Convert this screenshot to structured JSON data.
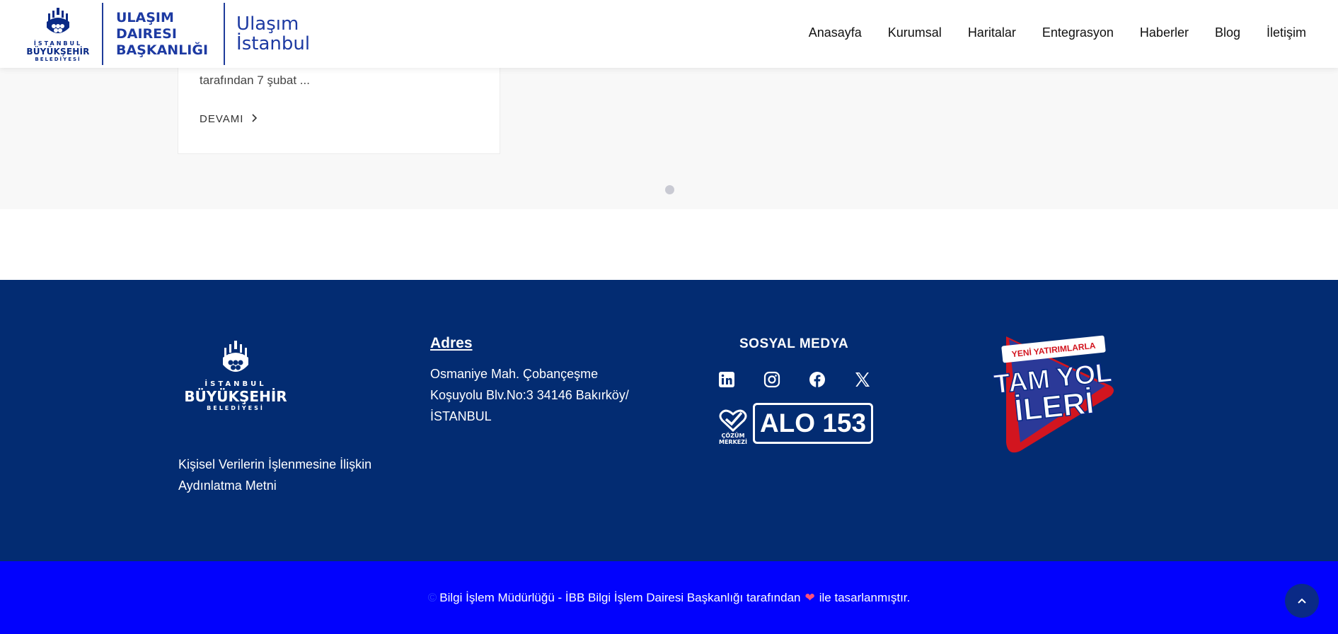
{
  "header": {
    "ibb_logo": {
      "line1": "İSTANBUL",
      "line2": "BÜYÜKŞEHİR",
      "line3": "BELEDİYESİ"
    },
    "department": [
      "ULAŞIM",
      "DAIRESI",
      "BAŞKANLIĞI"
    ],
    "brand": [
      "Ulaşım",
      "İstanbul"
    ],
    "nav": [
      "Anasayfa",
      "Kurumsal",
      "Haritalar",
      "Entegrasyon",
      "Haberler",
      "Blog",
      "İletişim"
    ]
  },
  "card": {
    "excerpt": "tarafından 7 şubat ...",
    "more_label": "DEVAMI",
    "more_icon": "chevron-right-icon"
  },
  "footer": {
    "logo": {
      "line1": "İSTANBUL",
      "line2": "BÜYÜKŞEHİR",
      "line3": "BELEDİYESİ"
    },
    "kvkk": "Kişisel Verilerin İşlenmesine İlişkin Aydınlatma Metni",
    "address_title": "Adres",
    "address_lines": [
      "Osmaniye Mah. Çobançeşme",
      "Koşuyolu Blv.No:3 34146 Bakırköy/",
      "İSTANBUL"
    ],
    "social_title": "SOSYAL MEDYA",
    "social": [
      "linkedin-icon",
      "instagram-icon",
      "facebook-icon",
      "x-icon"
    ],
    "alo_badge": {
      "top": "ÇÖZÜM",
      "bottom": "MERKEZİ",
      "number": "ALO 153"
    },
    "campaign": {
      "line1": "YENİ YATIRIMLARLA",
      "line2": "TAM YOL",
      "line3": "İLERİ"
    }
  },
  "bottom": {
    "copyright_symbol": "©",
    "text_before": "Bilgi İşlem Müdürlüğü - İBB Bilgi İşlem Dairesi Başkanlığı tarafından",
    "text_after": "ile tasarlanmıştır."
  },
  "colors": {
    "footer_bg": "#032c72",
    "bottom_bg": "#0202fd",
    "brand_blue": "#1d3aa2"
  }
}
